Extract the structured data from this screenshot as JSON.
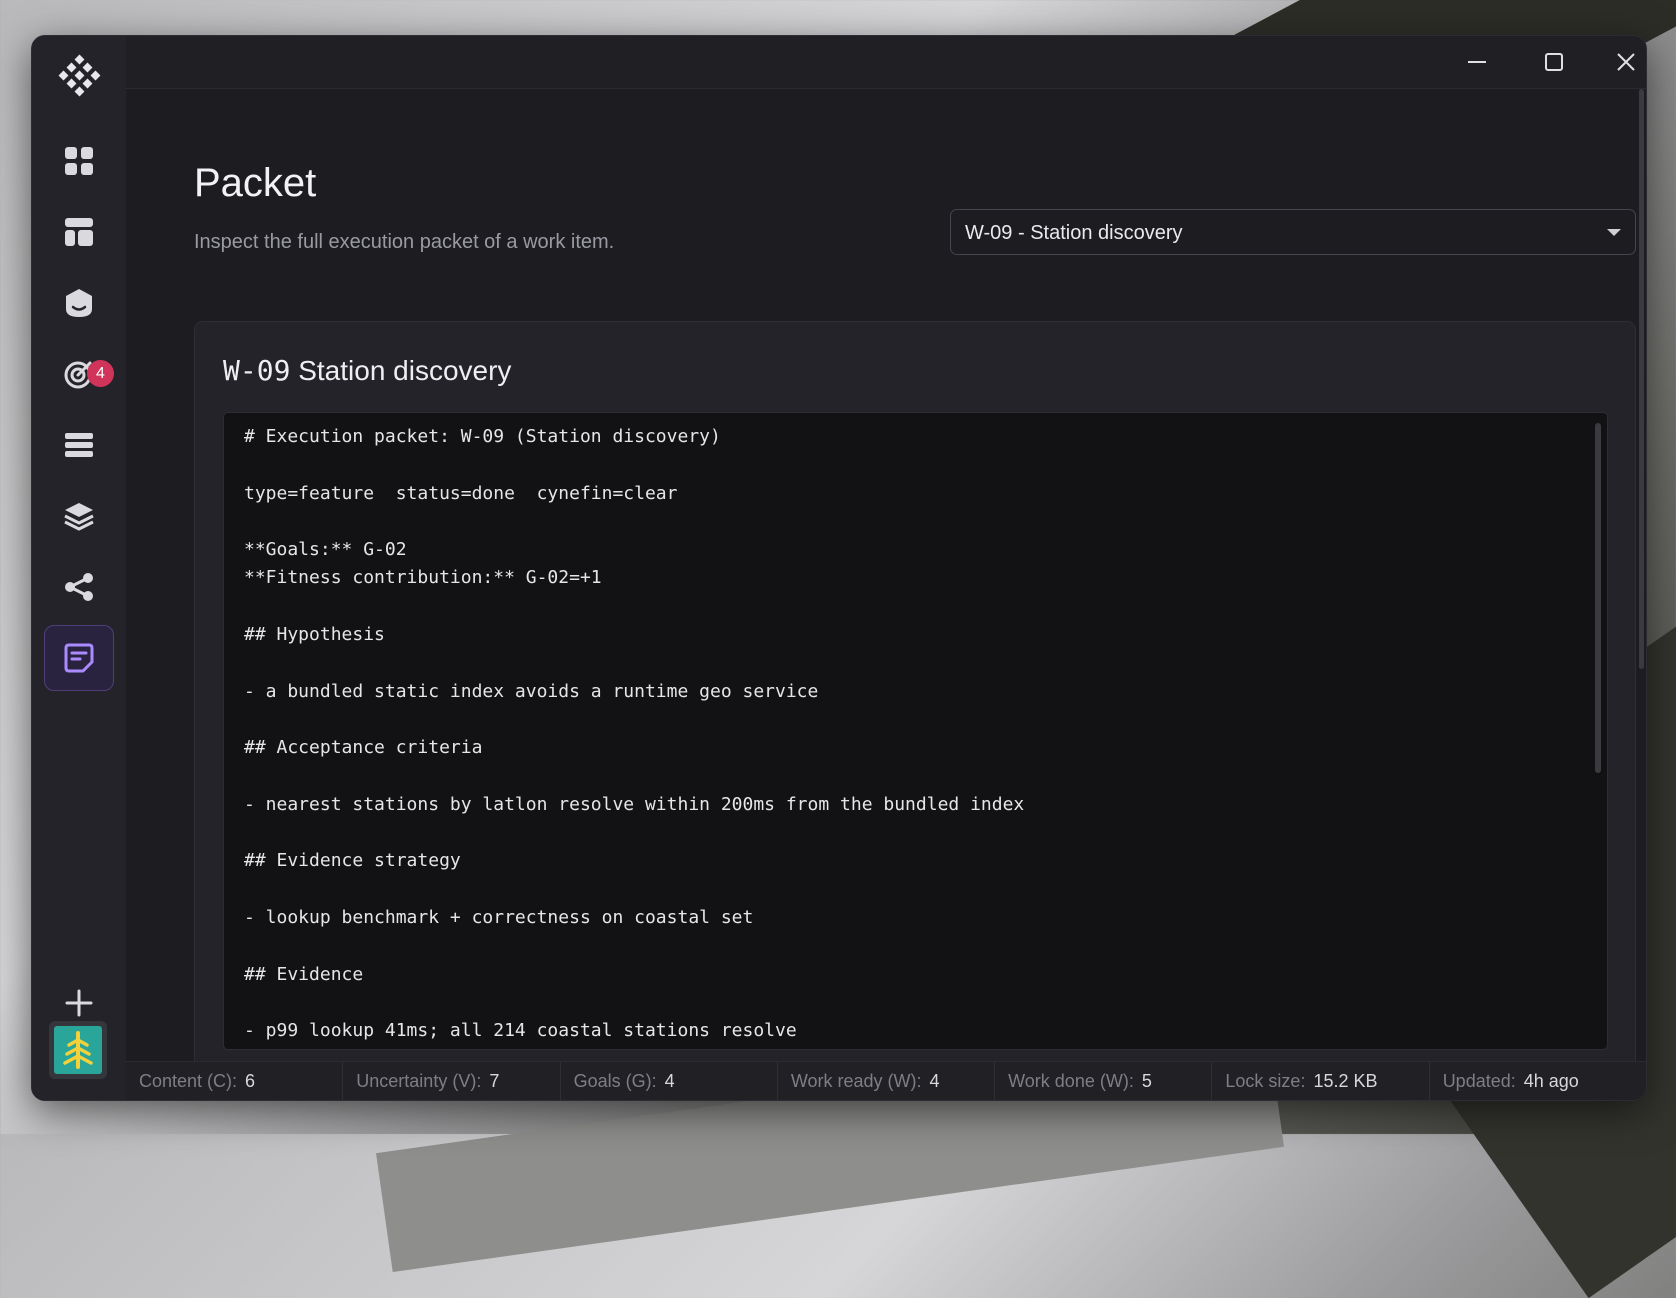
{
  "window": {
    "controls": [
      "minimize-icon",
      "maximize-icon",
      "close-icon"
    ]
  },
  "sidebar": {
    "items": [
      {
        "name": "dashboard",
        "icon": "grid-icon"
      },
      {
        "name": "board",
        "icon": "layout-icon"
      },
      {
        "name": "agent",
        "icon": "bot-icon"
      },
      {
        "name": "goals",
        "icon": "target-icon",
        "badge": "4"
      },
      {
        "name": "list",
        "icon": "list-icon"
      },
      {
        "name": "layers",
        "icon": "layers-icon"
      },
      {
        "name": "graph",
        "icon": "share-icon"
      },
      {
        "name": "packet",
        "icon": "note-icon",
        "active": true
      }
    ],
    "add_icon": "plus-icon",
    "workspace_icon": "tree-icon"
  },
  "header": {
    "title": "Packet",
    "subtitle": "Inspect the full execution packet of a work item."
  },
  "work_item_select": {
    "value": "W-09 - Station discovery"
  },
  "card": {
    "title_id": "W-09",
    "title_name": "Station discovery"
  },
  "packet_lines": [
    "# Execution packet: W-09 (Station discovery)",
    "",
    "type=feature  status=done  cynefin=clear",
    "",
    "**Goals:** G-02",
    "**Fitness contribution:** G-02=+1",
    "",
    "## Hypothesis",
    "",
    "- a bundled static index avoids a runtime geo service",
    "",
    "## Acceptance criteria",
    "",
    "- nearest stations by latlon resolve within 200ms from the bundled index",
    "",
    "## Evidence strategy",
    "",
    "- lookup benchmark + correctness on coastal set",
    "",
    "## Evidence",
    "",
    "- p99 lookup 41ms; all 214 coastal stations resolve"
  ],
  "status": [
    {
      "label": "Content (C):",
      "value": "6"
    },
    {
      "label": "Uncertainty (V):",
      "value": "7"
    },
    {
      "label": "Goals (G):",
      "value": "4"
    },
    {
      "label": "Work ready (W):",
      "value": "4"
    },
    {
      "label": "Work done (W):",
      "value": "5"
    },
    {
      "label": "Lock size:",
      "value": "15.2 KB"
    },
    {
      "label": "Updated:",
      "value": "4h ago"
    }
  ],
  "colors": {
    "accent": "#8b6cf0",
    "badge": "#d0345a",
    "workspace": "#2aa59a"
  }
}
